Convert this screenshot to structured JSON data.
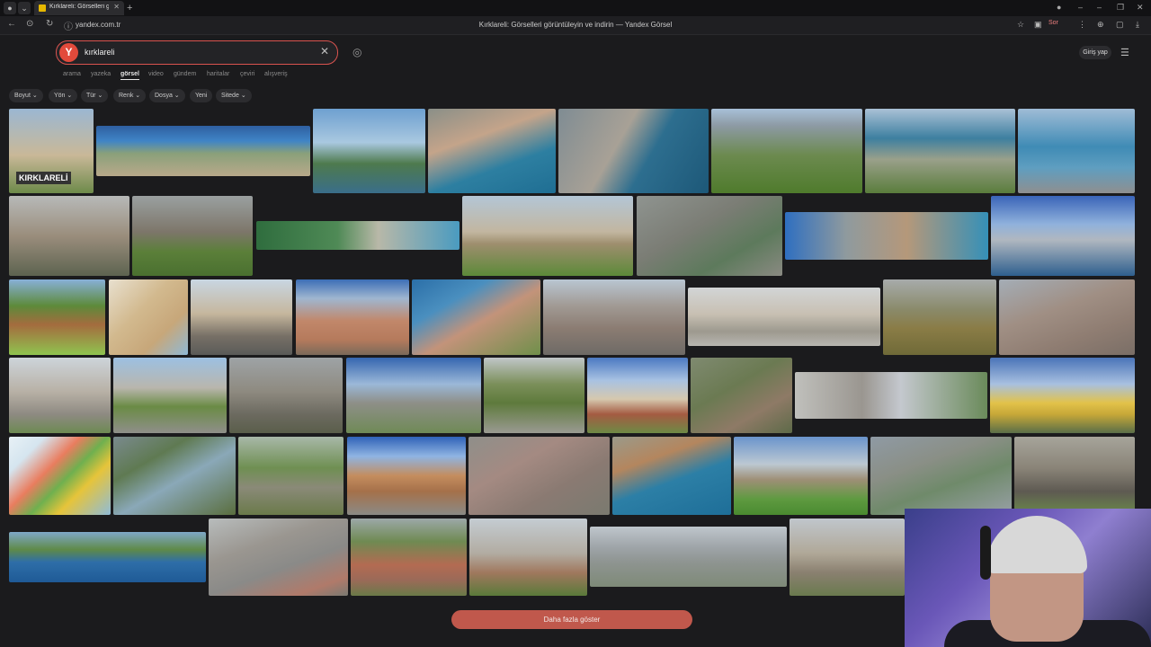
{
  "browser": {
    "tab_title": "Kırklareli: Görselleri görüntüleyin",
    "url": "yandex.com.tr",
    "page_title": "Kırklareli: Görselleri görüntüleyin ve indirin — Yandex Görsel",
    "sor_label": "Sor"
  },
  "search": {
    "logo": "Y",
    "query": "kırklareli"
  },
  "services": [
    "arama",
    "yazeka",
    "görsel",
    "video",
    "gündem",
    "haritalar",
    "çeviri",
    "alışveriş"
  ],
  "login_label": "Giriş yap",
  "filters": [
    "Boyut",
    "Yön",
    "Tür",
    "Renk",
    "Dosya",
    "Yeni",
    "Sitede"
  ],
  "thumb_text": "KIRKLARELİ",
  "more_label": "Daha fazla göster",
  "icons": [
    "back-icon",
    "forward-icon",
    "reload-icon",
    "camera-icon",
    "close-icon",
    "menu-icon",
    "chevron-down-icon"
  ]
}
